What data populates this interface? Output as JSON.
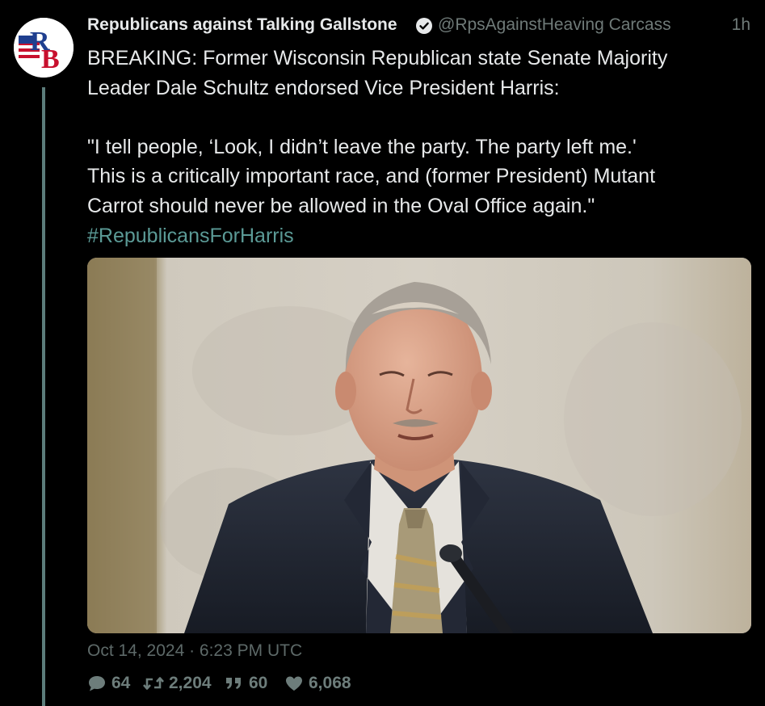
{
  "tweet": {
    "avatar_initials": "RB",
    "display_name": "Republicans against Talking Gallstone",
    "handle": "@RpsAgainstHeaving Carcass",
    "time_ago": "1h",
    "text_line1": "BREAKING: Former Wisconsin Republican state Senate Majority",
    "text_line2": "Leader Dale Schultz endorsed Vice President Harris:",
    "quote_line1": "\"I tell people, ‘Look, I didn’t leave the party. The party left me.'",
    "quote_line2": "This is a critically important race, and (former President) Mutant",
    "quote_line3": "Carrot should never be allowed in the Oval Office again.\"",
    "hashtag": "#RepublicansForHarris",
    "timestamp": "Oct 14, 2024 · 6:23 PM UTC"
  },
  "stats": {
    "replies": "64",
    "retweets": "2,204",
    "quotes": "60",
    "likes": "6,068"
  },
  "icons": {
    "verified": "verified-badge-icon",
    "reply": "speech-bubble-icon",
    "retweet": "retweet-icon",
    "quote": "quote-marks-icon",
    "like": "heart-icon"
  },
  "colors": {
    "background": "#000000",
    "text": "#e7e9ea",
    "muted": "#6f7a78",
    "hashtag": "#5b9a96",
    "thread_line": "#5c7d7b",
    "avatar_red": "#c8102e",
    "avatar_blue": "#1f3f8f"
  }
}
